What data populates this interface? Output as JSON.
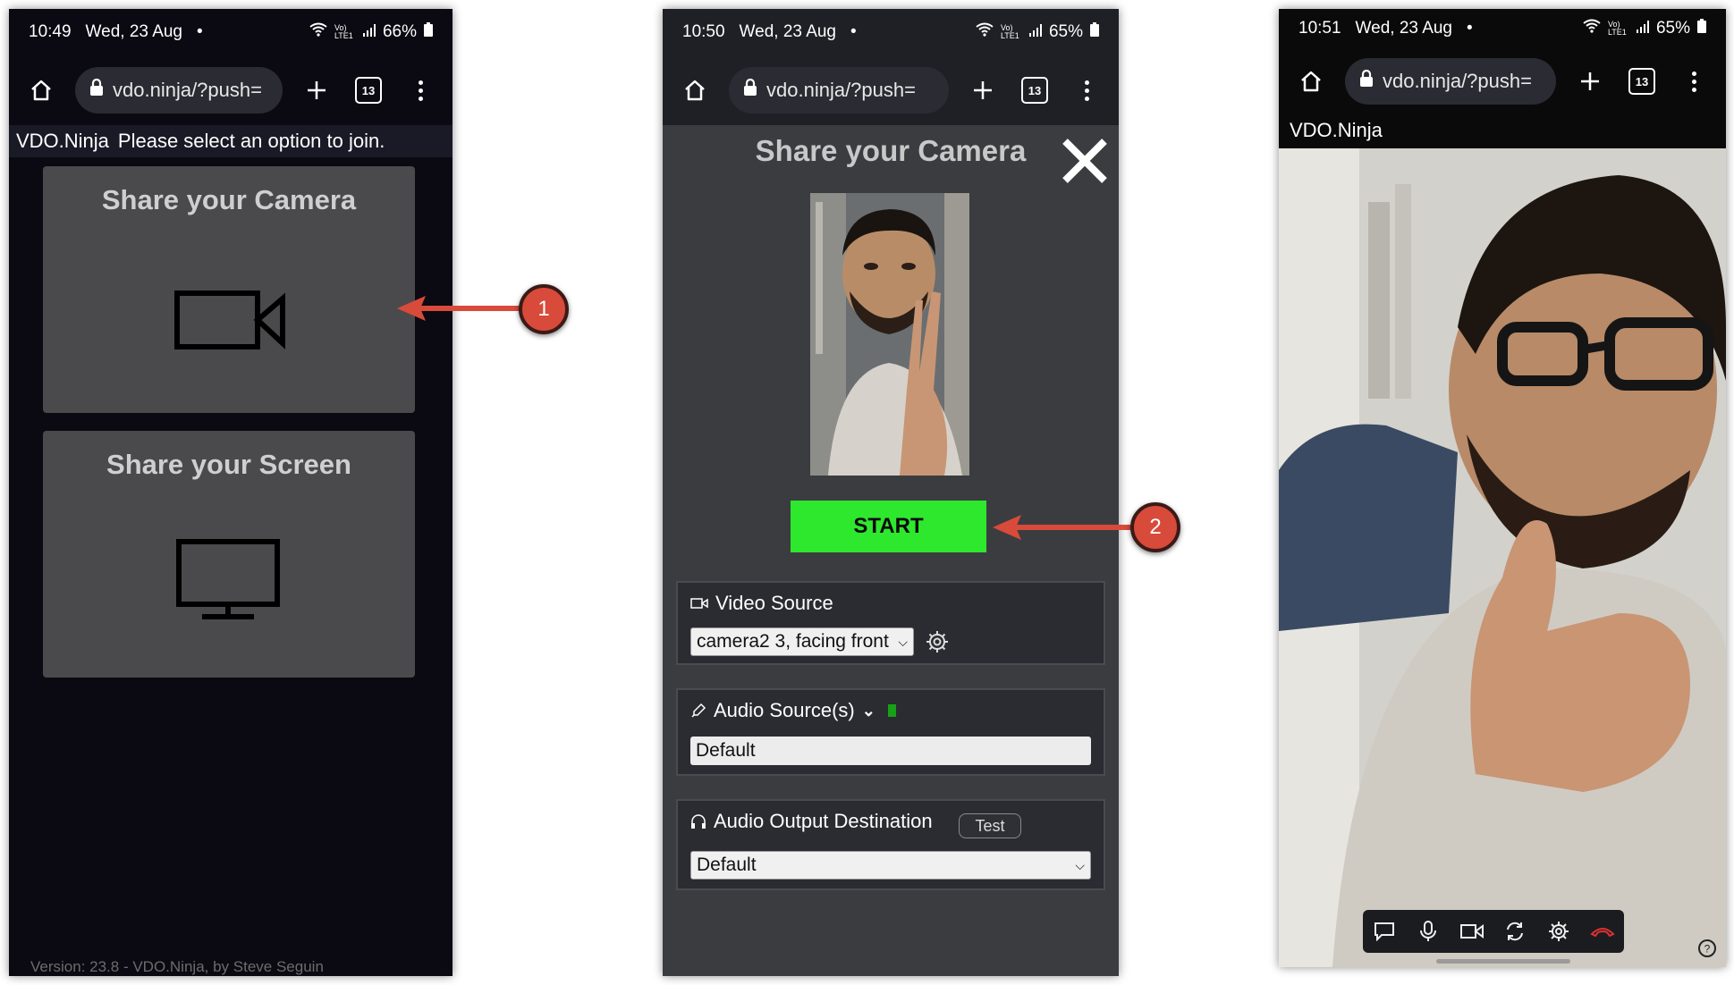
{
  "phone1": {
    "status": {
      "time": "10:49",
      "date": "Wed, 23 Aug",
      "dot": "•",
      "signal": "Vo) LTE1",
      "battery": "66%"
    },
    "url": "vdo.ninja/?push=",
    "tab_count": "13",
    "header": {
      "brand": "VDO.Ninja",
      "message": "Please select an option to join."
    },
    "camera_card": {
      "title": "Share your Camera",
      "icon": "video-camera-icon"
    },
    "screen_card": {
      "title": "Share your Screen",
      "icon": "monitor-icon"
    },
    "version": "Version: 23.8 - VDO.Ninja, by Steve Seguin"
  },
  "phone2": {
    "status": {
      "time": "10:50",
      "date": "Wed, 23 Aug",
      "dot": "•",
      "signal": "Vo) LTE1",
      "battery": "65%"
    },
    "url": "vdo.ninja/?push=",
    "tab_count": "13",
    "title": "Share your Camera",
    "start_label": "START",
    "video_source": {
      "label": "Video Source",
      "selected": "camera2 3, facing front"
    },
    "audio_source": {
      "label": "Audio Source(s)",
      "selected": "Default"
    },
    "audio_output": {
      "label": "Audio Output Destination",
      "test_label": "Test",
      "selected": "Default"
    }
  },
  "phone3": {
    "status": {
      "time": "10:51",
      "date": "Wed, 23 Aug",
      "dot": "•",
      "signal": "Vo) LTE1",
      "battery": "65%"
    },
    "url": "vdo.ninja/?push=",
    "tab_count": "13",
    "header": "VDO.Ninja",
    "toolbar_icons": [
      "chat-icon",
      "microphone-icon",
      "camera-icon",
      "rotate-icon",
      "gear-icon",
      "hangup-icon"
    ]
  },
  "callouts": {
    "one": "1",
    "two": "2"
  },
  "colors": {
    "start_green": "#2ee82e",
    "callout_red": "#d84a3a",
    "hangup_red": "#e03030"
  }
}
